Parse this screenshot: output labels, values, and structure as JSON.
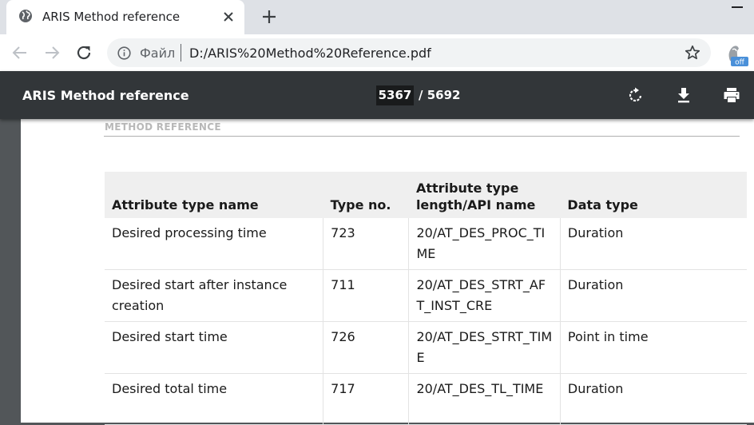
{
  "browser": {
    "tab": {
      "title": "ARIS Method reference"
    },
    "address_bar": {
      "scheme_label": "Файл",
      "url": "D:/ARIS%20Method%20Reference.pdf"
    },
    "extension": {
      "badge": "off"
    }
  },
  "pdf_viewer": {
    "title": "ARIS Method reference",
    "current_page": "5367",
    "total_pages": "/ 5692"
  },
  "document": {
    "section_header": "METHOD REFERENCE",
    "table": {
      "headers": [
        "Attribute type name",
        "Type no.",
        "Attribute type length/API name",
        "Data type"
      ],
      "rows": [
        [
          "Desired processing time",
          "723",
          "20/AT_DES_PROC_TIME",
          "Duration"
        ],
        [
          "Desired start after instance creation",
          "711",
          "20/AT_DES_STRT_AFT_INST_CRE",
          "Duration"
        ],
        [
          "Desired start time",
          "726",
          "20/AT_DES_STRT_TIME",
          "Point in time"
        ],
        [
          "Desired total time",
          "717",
          "20/AT_DES_TL_TIME",
          "Duration"
        ]
      ]
    }
  }
}
